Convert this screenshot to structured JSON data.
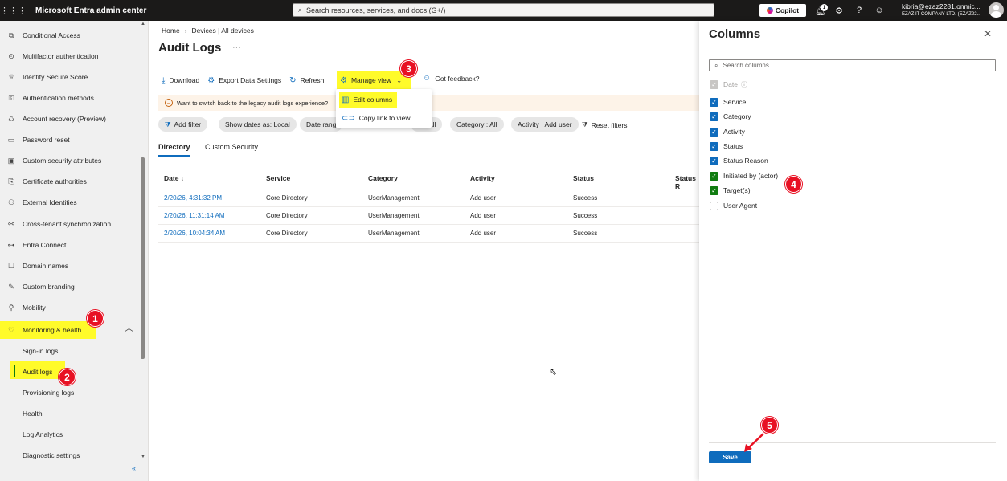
{
  "app": {
    "title": "Microsoft Entra admin center",
    "waffle_icon": "waffle-icon"
  },
  "search": {
    "placeholder": "Search resources, services, and docs (G+/)"
  },
  "topbar": {
    "copilot_label": "Copilot",
    "notification_count": "1",
    "account_email": "kibria@ezaz2281.onmic...",
    "account_org": "EZAZ IT COMPANY LTD. (EZAZ22..."
  },
  "sidebar": {
    "items": [
      {
        "label": "Conditional Access",
        "icon": "conditional-access-icon"
      },
      {
        "label": "Multifactor authentication",
        "icon": "mfa-icon"
      },
      {
        "label": "Identity Secure Score",
        "icon": "trophy-icon"
      },
      {
        "label": "Authentication methods",
        "icon": "key-icon"
      },
      {
        "label": "Account recovery (Preview)",
        "icon": "account-recovery-icon"
      },
      {
        "label": "Password reset",
        "icon": "password-icon"
      },
      {
        "label": "Custom security attributes",
        "icon": "attributes-icon"
      },
      {
        "label": "Certificate authorities",
        "icon": "certificate-icon"
      },
      {
        "label": "External Identities",
        "icon": "external-identities-icon"
      },
      {
        "label": "Cross-tenant synchronization",
        "icon": "sync-icon"
      },
      {
        "label": "Entra Connect",
        "icon": "connect-icon"
      },
      {
        "label": "Domain names",
        "icon": "domain-icon"
      },
      {
        "label": "Custom branding",
        "icon": "branding-icon"
      },
      {
        "label": "Mobility",
        "icon": "mobility-icon"
      },
      {
        "label": "Monitoring & health",
        "icon": "monitoring-icon"
      }
    ],
    "sub_items": [
      {
        "label": "Sign-in logs"
      },
      {
        "label": "Audit logs"
      },
      {
        "label": "Provisioning logs"
      },
      {
        "label": "Health"
      },
      {
        "label": "Log Analytics"
      },
      {
        "label": "Diagnostic settings"
      }
    ]
  },
  "badges": {
    "b1": "1",
    "b2": "2",
    "b3": "3",
    "b4": "4",
    "b5": "5"
  },
  "breadcrumb": {
    "home": "Home",
    "sep": "›",
    "devices": "Devices | All devices"
  },
  "page": {
    "title": "Audit Logs",
    "more": "···"
  },
  "toolbar": {
    "download": "Download",
    "export": "Export Data Settings",
    "refresh": "Refresh",
    "manage_view": "Manage view",
    "feedback": "Got feedback?"
  },
  "dropdown": {
    "edit_columns": "Edit columns",
    "copy_link": "Copy link to view"
  },
  "banner": {
    "text": "Want to switch back to the legacy audit logs experience?"
  },
  "filters": {
    "add_filter": "Add filter",
    "show_dates": "Show dates as: Local",
    "date_range": "Date rang",
    "all": "All",
    "category": "Category : All",
    "activity": "Activity : Add user",
    "reset": "Reset filters"
  },
  "tabs": [
    {
      "label": "Directory"
    },
    {
      "label": "Custom Security"
    }
  ],
  "table": {
    "headers": [
      "Date ↓",
      "Service",
      "Category",
      "Activity",
      "Status",
      "Status R"
    ],
    "rows": [
      [
        "2/20/26, 4:31:32 PM",
        "Core Directory",
        "UserManagement",
        "Add user",
        "Success"
      ],
      [
        "2/20/26, 11:31:14 AM",
        "Core Directory",
        "UserManagement",
        "Add user",
        "Success"
      ],
      [
        "2/20/26, 10:04:34 AM",
        "Core Directory",
        "UserManagement",
        "Add user",
        "Success"
      ]
    ]
  },
  "columns_panel": {
    "title": "Columns",
    "search_placeholder": "Search columns",
    "items": [
      {
        "label": "Date",
        "state": "disabled"
      },
      {
        "label": "Service",
        "state": "checked"
      },
      {
        "label": "Category",
        "state": "checked"
      },
      {
        "label": "Activity",
        "state": "checked"
      },
      {
        "label": "Status",
        "state": "checked"
      },
      {
        "label": "Status Reason",
        "state": "checked"
      },
      {
        "label": "Initiated by (actor)",
        "state": "checked"
      },
      {
        "label": "Target(s)",
        "state": "checked"
      },
      {
        "label": "User Agent",
        "state": "unchecked"
      }
    ],
    "save": "Save"
  },
  "colors": {
    "accent": "#0f6cbd",
    "highlight": "#fffb2a",
    "badge": "#e81123",
    "topbar": "#1b1a19"
  }
}
